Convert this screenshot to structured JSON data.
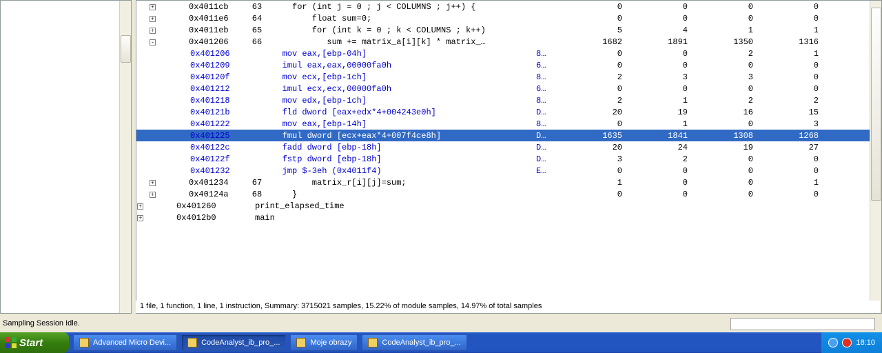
{
  "rows": [
    {
      "tree": "+",
      "addr": "0x4011cb",
      "line": "63",
      "code": "     for (int j = 0 ; j < COLUMNS ; j++) {",
      "cls": "src",
      "v": "",
      "n1": "0",
      "n2": "0",
      "n3": "0",
      "n4": "0"
    },
    {
      "tree": "+",
      "addr": "0x4011e6",
      "line": "64",
      "code": "         float sum=0;",
      "cls": "src",
      "v": "",
      "n1": "0",
      "n2": "0",
      "n3": "0",
      "n4": "0"
    },
    {
      "tree": "+",
      "addr": "0x4011eb",
      "line": "65",
      "code": "         for (int k = 0 ; k < COLUMNS ; k++)",
      "cls": "src",
      "v": "",
      "n1": "5",
      "n2": "4",
      "n3": "1",
      "n4": "1"
    },
    {
      "tree": "-",
      "addr": "0x401206",
      "line": "66",
      "code": "            sum += matrix_a[i][k] * matrix_…",
      "cls": "src",
      "v": "",
      "n1": "1682",
      "n2": "1891",
      "n3": "1350",
      "n4": "1316"
    },
    {
      "tree": "",
      "addrSub": true,
      "addr": "0x401206",
      "line": "",
      "code": "mov eax,[ebp-04h]",
      "cls": "asm",
      "v": "8…",
      "n1": "0",
      "n2": "0",
      "n3": "2",
      "n4": "1"
    },
    {
      "tree": "",
      "addrSub": true,
      "addr": "0x401209",
      "line": "",
      "code": "imul eax,eax,00000fa0h",
      "cls": "asm",
      "v": "6…",
      "n1": "0",
      "n2": "0",
      "n3": "0",
      "n4": "0"
    },
    {
      "tree": "",
      "addrSub": true,
      "addr": "0x40120f",
      "line": "",
      "code": "mov ecx,[ebp-1ch]",
      "cls": "asm",
      "v": "8…",
      "n1": "2",
      "n2": "3",
      "n3": "3",
      "n4": "0"
    },
    {
      "tree": "",
      "addrSub": true,
      "addr": "0x401212",
      "line": "",
      "code": "imul ecx,ecx,00000fa0h",
      "cls": "asm",
      "v": "6…",
      "n1": "0",
      "n2": "0",
      "n3": "0",
      "n4": "0"
    },
    {
      "tree": "",
      "addrSub": true,
      "addr": "0x401218",
      "line": "",
      "code": "mov edx,[ebp-1ch]",
      "cls": "asm",
      "v": "8…",
      "n1": "2",
      "n2": "1",
      "n3": "2",
      "n4": "2"
    },
    {
      "tree": "",
      "addrSub": true,
      "addr": "0x40121b",
      "line": "",
      "code": "fld dword [eax+edx*4+004243e0h]",
      "cls": "asm",
      "v": "D…",
      "n1": "20",
      "n2": "19",
      "n3": "16",
      "n4": "15"
    },
    {
      "tree": "",
      "addrSub": true,
      "addr": "0x401222",
      "line": "",
      "code": "mov eax,[ebp-14h]",
      "cls": "asm",
      "v": "8…",
      "n1": "0",
      "n2": "1",
      "n3": "0",
      "n4": "3"
    },
    {
      "tree": "",
      "addrSub": true,
      "addr": "0x401225",
      "line": "",
      "sel": true,
      "code": "fmul dword [ecx+eax*4+007f4ce8h]",
      "cls": "asm",
      "v": "D…",
      "n1": "1635",
      "n2": "1841",
      "n3": "1308",
      "n4": "1268"
    },
    {
      "tree": "",
      "addrSub": true,
      "addr": "0x40122c",
      "line": "",
      "code": "fadd dword [ebp-18h]",
      "cls": "asm",
      "v": "D…",
      "n1": "20",
      "n2": "24",
      "n3": "19",
      "n4": "27"
    },
    {
      "tree": "",
      "addrSub": true,
      "addr": "0x40122f",
      "line": "",
      "code": "fstp dword [ebp-18h]",
      "cls": "asm",
      "v": "D…",
      "n1": "3",
      "n2": "2",
      "n3": "0",
      "n4": "0"
    },
    {
      "tree": "",
      "addrSub": true,
      "addr": "0x401232",
      "line": "",
      "code": "jmp $-3eh (0x4011f4)",
      "cls": "asm",
      "v": "E…",
      "n1": "0",
      "n2": "0",
      "n3": "0",
      "n4": "0"
    },
    {
      "tree": "+",
      "addr": "0x401234",
      "line": "67",
      "code": "         matrix_r[i][j]=sum;",
      "cls": "src",
      "v": "",
      "n1": "1",
      "n2": "0",
      "n3": "0",
      "n4": "1"
    },
    {
      "tree": "+",
      "addr": "0x40124a",
      "line": "68",
      "code": "     }",
      "cls": "src",
      "v": "",
      "n1": "0",
      "n2": "0",
      "n3": "0",
      "n4": "0"
    },
    {
      "tree": "+",
      "addr": "0x401260",
      "line": "",
      "treeOffset": "-18",
      "code": "print_elapsed_time",
      "cls": "src",
      "v": "",
      "n1": "",
      "n2": "",
      "n3": "",
      "n4": ""
    },
    {
      "tree": "+",
      "addr": "0x4012b0",
      "line": "",
      "treeOffset": "-18",
      "code": "main",
      "cls": "src",
      "v": "",
      "n1": "",
      "n2": "",
      "n3": "",
      "n4": ""
    }
  ],
  "summary": "1 file, 1 function, 1 line, 1 instruction, Summary: 3715021 samples, 15.22% of module samples, 14.97% of total samples",
  "status": "Sampling Session Idle.",
  "taskbar": {
    "start": "Start",
    "items": [
      {
        "label": "Advanced Micro Devi...",
        "active": false
      },
      {
        "label": "CodeAnalyst_ib_pro_...",
        "active": true
      },
      {
        "label": "Moje obrazy",
        "active": false
      },
      {
        "label": "CodeAnalyst_ib_pro_...",
        "active": false
      }
    ],
    "time": "18:10"
  }
}
